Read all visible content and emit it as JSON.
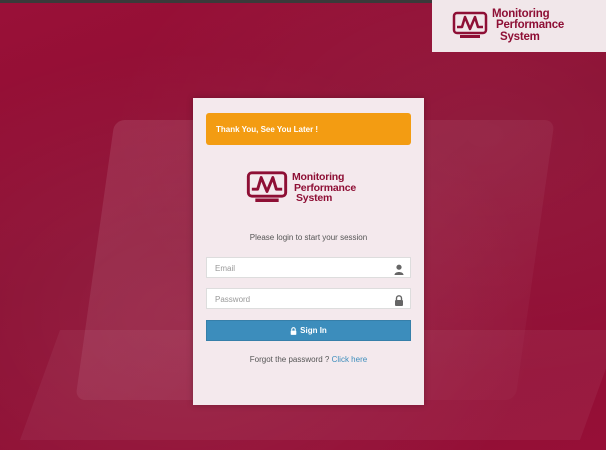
{
  "brand": {
    "line1": "Monitoring",
    "line2": "Performance",
    "line3": "System",
    "color": "#8e0f35"
  },
  "alert": {
    "message": "Thank You, See You Later !",
    "color": "#f39c12"
  },
  "login": {
    "subtitle": "Please login to start your session",
    "email_placeholder": "Email",
    "password_placeholder": "Password",
    "signin_label": "Sign In",
    "signin_color": "#3c8dbc",
    "forgot_text": "Forgot the password ?",
    "forgot_link": "Click here"
  },
  "icons": {
    "email": "user-icon",
    "password": "lock-icon",
    "signin": "lock-icon"
  }
}
